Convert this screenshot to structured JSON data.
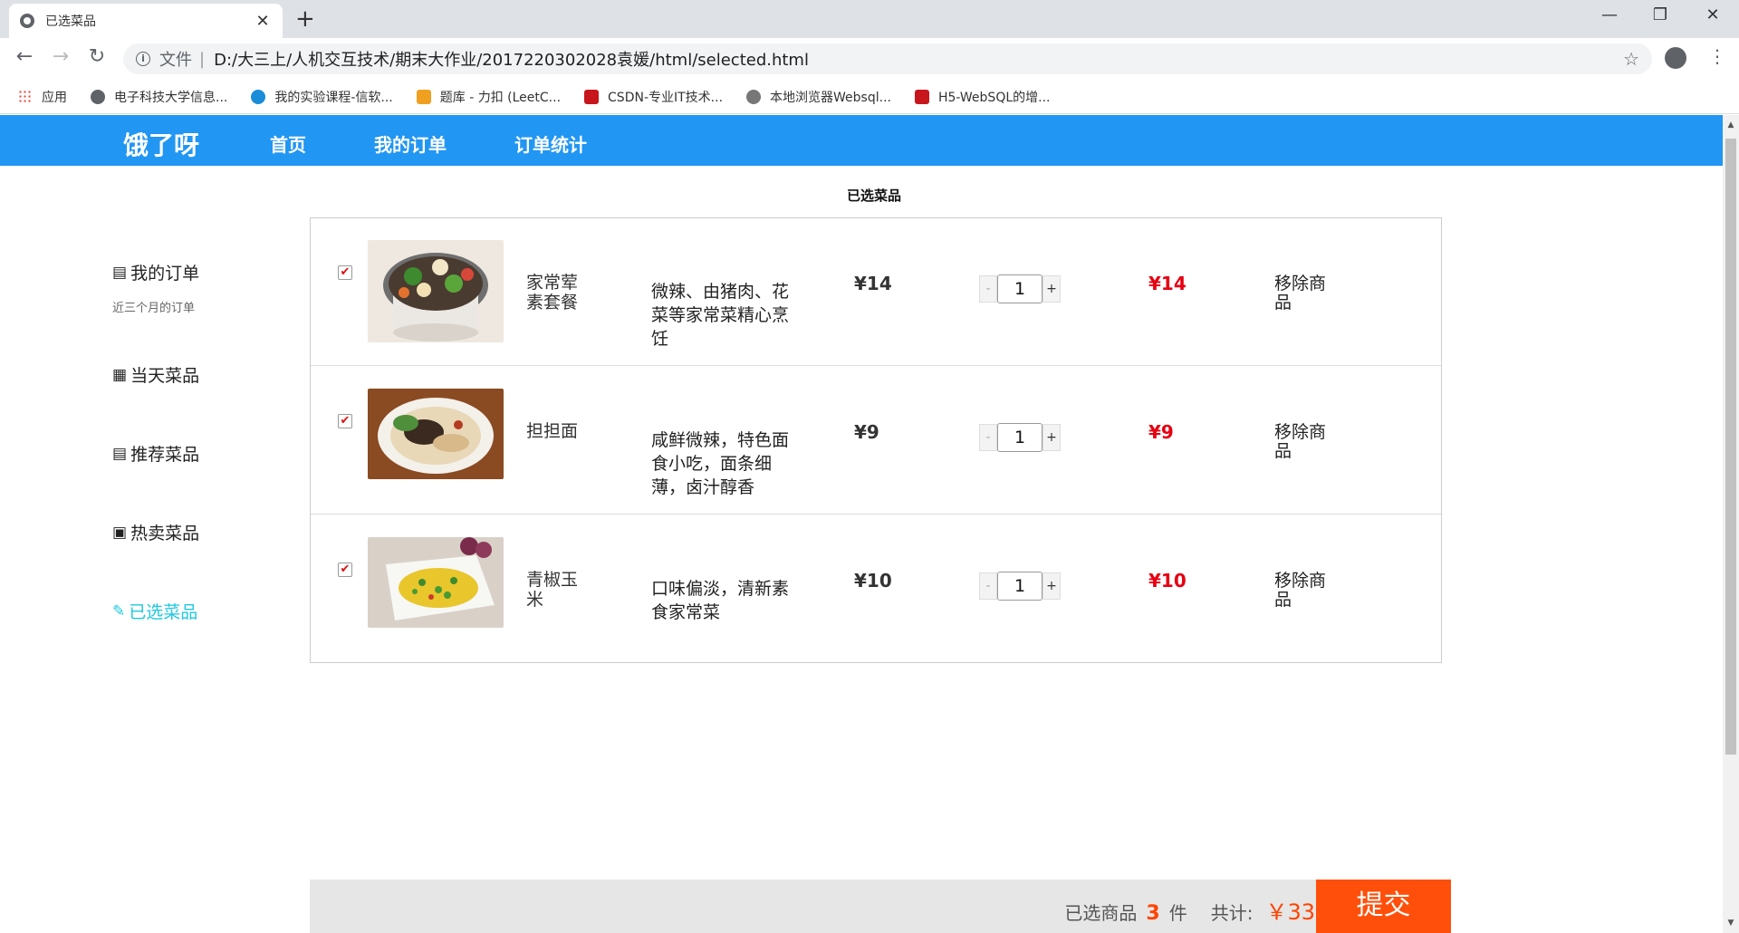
{
  "browser": {
    "tab_title": "已选菜品",
    "tab_close": "✕",
    "new_tab": "+",
    "scheme_label": "文件",
    "separator": "|",
    "url": "D:/大三上/人机交互技术/期末大作业/2017220302028袁媛/html/selected.html",
    "bookmarks": [
      {
        "label": "应用",
        "color": "#e94235"
      },
      {
        "label": "电子科技大学信息...",
        "color": "#5f6368"
      },
      {
        "label": "我的实验课程-信软...",
        "color": "#1a8cd8"
      },
      {
        "label": "题库 - 力扣 (LeetC...",
        "color": "#f0a020"
      },
      {
        "label": "CSDN-专业IT技术...",
        "color": "#c8161d"
      },
      {
        "label": "本地浏览器Websql...",
        "color": "#555555"
      },
      {
        "label": "H5-WebSQL的增...",
        "color": "#c8161d"
      }
    ]
  },
  "site": {
    "brand": "饿了呀",
    "nav": [
      "首页",
      "我的订单",
      "订单统计"
    ],
    "accent": "#2196f3"
  },
  "page": {
    "title": "已选菜品"
  },
  "sidebar": {
    "items": [
      {
        "icon": "order-list-icon",
        "glyph": "▤",
        "label": "我的订单"
      },
      {
        "icon": "calendar-icon",
        "glyph": "▦",
        "label": "当天菜品"
      },
      {
        "icon": "list-icon",
        "glyph": "▤",
        "label": "推荐菜品"
      },
      {
        "icon": "hot-icon",
        "glyph": "▣",
        "label": "热卖菜品"
      },
      {
        "icon": "selected-icon",
        "glyph": "✎",
        "label": "已选菜品"
      }
    ],
    "order_sub": "近三个月的订单",
    "active_color": "#1ec8e0"
  },
  "cart": {
    "remove_label": "移除商品",
    "items": [
      {
        "name": "家常荤素套餐",
        "desc": "微辣、由猪肉、花菜等家常菜精心烹饪",
        "price": "¥14",
        "qty": "1",
        "subtotal": "¥14",
        "checked": "✔"
      },
      {
        "name": "担担面",
        "desc": "咸鲜微辣，特色面食小吃，面条细薄，卤汁醇香",
        "price": "¥9",
        "qty": "1",
        "subtotal": "¥9",
        "checked": "✔"
      },
      {
        "name": "青椒玉米",
        "desc": "口味偏淡，清新素食家常菜",
        "price": "¥10",
        "qty": "1",
        "subtotal": "¥10",
        "checked": "✔"
      }
    ],
    "minus": "-",
    "plus": "+"
  },
  "footer": {
    "selected_label": "已选商品",
    "count": "3",
    "unit": "件",
    "total_label": "共计:",
    "total": "￥33",
    "submit": "提交"
  }
}
